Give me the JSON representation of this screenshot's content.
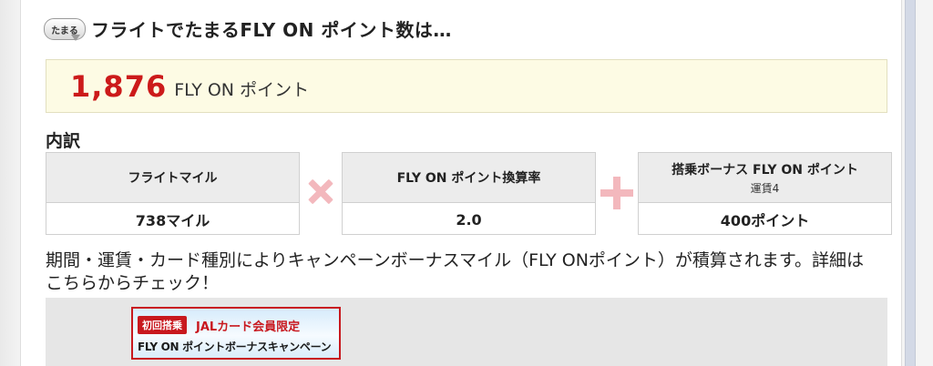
{
  "heading": {
    "badge": "たまる",
    "title": "フライトでたまるFLY ON ポイント数は…"
  },
  "total": {
    "value": "1,876",
    "unit": "FLY ON ポイント"
  },
  "breakdown": {
    "label": "内訳",
    "miles": {
      "header": "フライトマイル",
      "value": "738マイル"
    },
    "rate": {
      "header": "FLY ON ポイント換算率",
      "value": "2.0"
    },
    "bonus": {
      "header": "搭乗ボーナス FLY ON ポイント",
      "sub": "運賃4",
      "value": "400ポイント"
    },
    "operators": [
      "times-icon",
      "plus-icon"
    ]
  },
  "campaign": {
    "text": "期間・運賃・カード種別によりキャンペーンボーナスマイル（FLY ONポイント）が積算されます。詳細はこちらからチェック！",
    "banner": {
      "tag": "初回搭乗",
      "member": "JALカード会員限定",
      "title": "FLY ON ポイントボーナスキャンペーン"
    }
  },
  "colors": {
    "accent_red": "#cc1a1a",
    "operator_pink": "#f3b8bd",
    "total_box_bg": "#fdfbe4"
  }
}
